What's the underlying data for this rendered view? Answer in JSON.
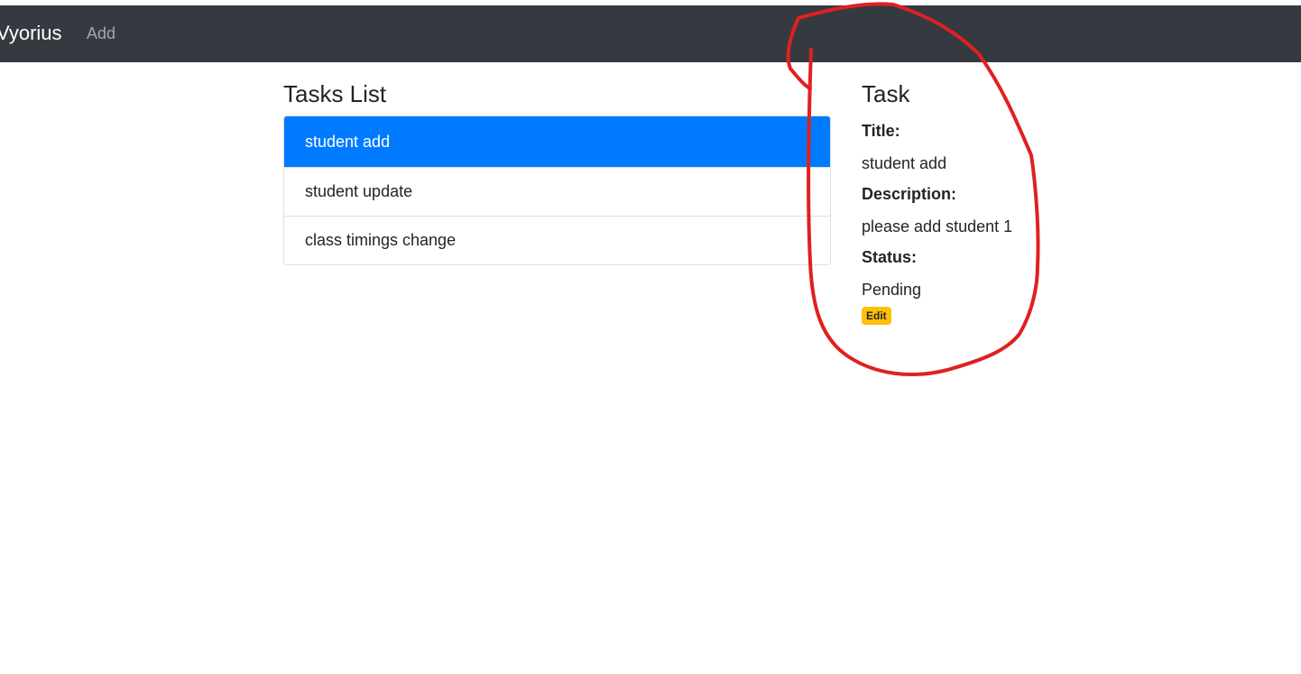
{
  "navbar": {
    "brand": "Vyorius",
    "links": [
      "Add"
    ]
  },
  "tasks_list": {
    "heading": "Tasks List",
    "items": [
      {
        "label": "student add",
        "active": true
      },
      {
        "label": "student update",
        "active": false
      },
      {
        "label": "class timings change",
        "active": false
      }
    ]
  },
  "task_detail": {
    "heading": "Task",
    "title_label": "Title:",
    "title_value": "student add",
    "description_label": "Description:",
    "description_value": "please add student 1",
    "status_label": "Status:",
    "status_value": "Pending",
    "edit_label": "Edit"
  },
  "colors": {
    "navbar": "#343a40",
    "active_item": "#007bff",
    "edit_badge": "#ffc107",
    "annotation": "#e02020"
  }
}
